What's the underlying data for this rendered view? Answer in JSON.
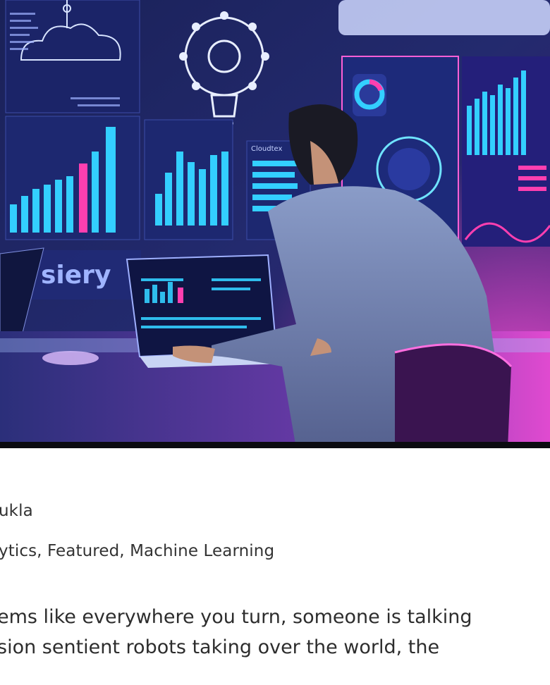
{
  "post": {
    "author_fragment": "ukla",
    "categories_fragment": "ytics, Featured, Machine Learning",
    "excerpt_lines": [
      "ems like everywhere you turn, someone is talking",
      "sion sentient robots taking over the world, the",
      ""
    ]
  },
  "hero_image": {
    "screen_text": [
      "siery",
      "Cloudtex"
    ]
  },
  "colors": {
    "bg_dark": "#141a4a",
    "neon_cyan": "#2fd8ff",
    "neon_pink": "#ff3fb0",
    "neon_purple": "#b04cff"
  }
}
